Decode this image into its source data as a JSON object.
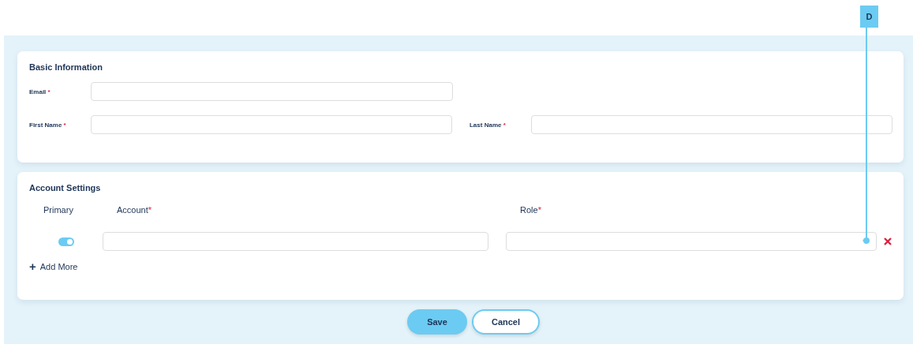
{
  "basic_information": {
    "title": "Basic Information",
    "fields": [
      {
        "label": "Email",
        "required_mark": "*"
      },
      {
        "label": "First Name",
        "required_mark": "*"
      },
      {
        "label": "Last Name",
        "required_mark": "*"
      }
    ]
  },
  "account_settings": {
    "title": "Account Settings",
    "columns": [
      {
        "label": "Primary"
      },
      {
        "label": "Account",
        "required_mark": "*"
      },
      {
        "label": "Role",
        "required_mark": "*"
      }
    ],
    "rows": [
      {
        "primary_on": true
      }
    ],
    "add_more": {
      "icon": "+",
      "label": "Add More"
    }
  },
  "buttons": [
    {
      "label": "Save",
      "kind": "primary"
    },
    {
      "label": "Cancel",
      "kind": "secondary"
    }
  ],
  "annotation": {
    "label": "D"
  }
}
